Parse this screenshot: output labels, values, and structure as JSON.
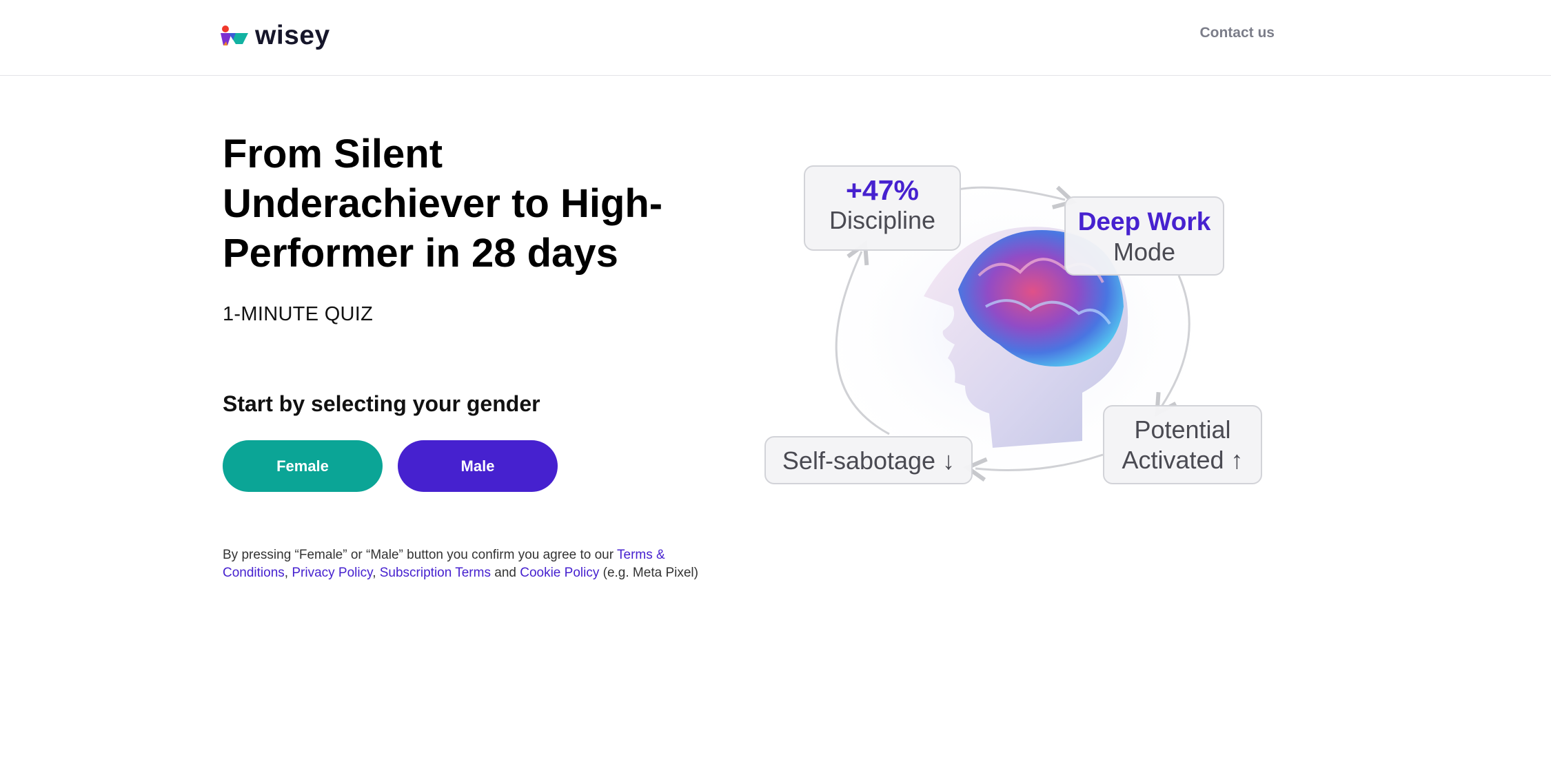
{
  "header": {
    "brand": "wisey",
    "contact_label": "Contact us"
  },
  "hero": {
    "title": "From Silent Underachiever to High-Performer in 28 days",
    "quiz_label": "1-MINUTE QUIZ",
    "gender_prompt": "Start by selecting your gender",
    "female_label": "Female",
    "male_label": "Male"
  },
  "disclaimer": {
    "prefix": "By pressing “Female” or “Male” button you confirm you agree to our ",
    "terms": "Terms & Conditions",
    "sep1": ", ",
    "privacy": "Privacy Policy",
    "sep2": ", ",
    "subscription": "Subscription Terms",
    "and": " and ",
    "cookie": "Cookie Policy",
    "suffix": " (e.g. Meta Pixel)"
  },
  "illustration": {
    "discipline_value": "+47%",
    "discipline_label": "Discipline",
    "deepwork_value": "Deep Work",
    "deepwork_label": "Mode",
    "sabotage_label": "Self-sabotage ↓",
    "potential_line1": "Potential",
    "potential_line2": "Activated ↑"
  },
  "colors": {
    "female_button": "#0ba596",
    "male_button": "#4621cf",
    "link": "#4621cf"
  }
}
